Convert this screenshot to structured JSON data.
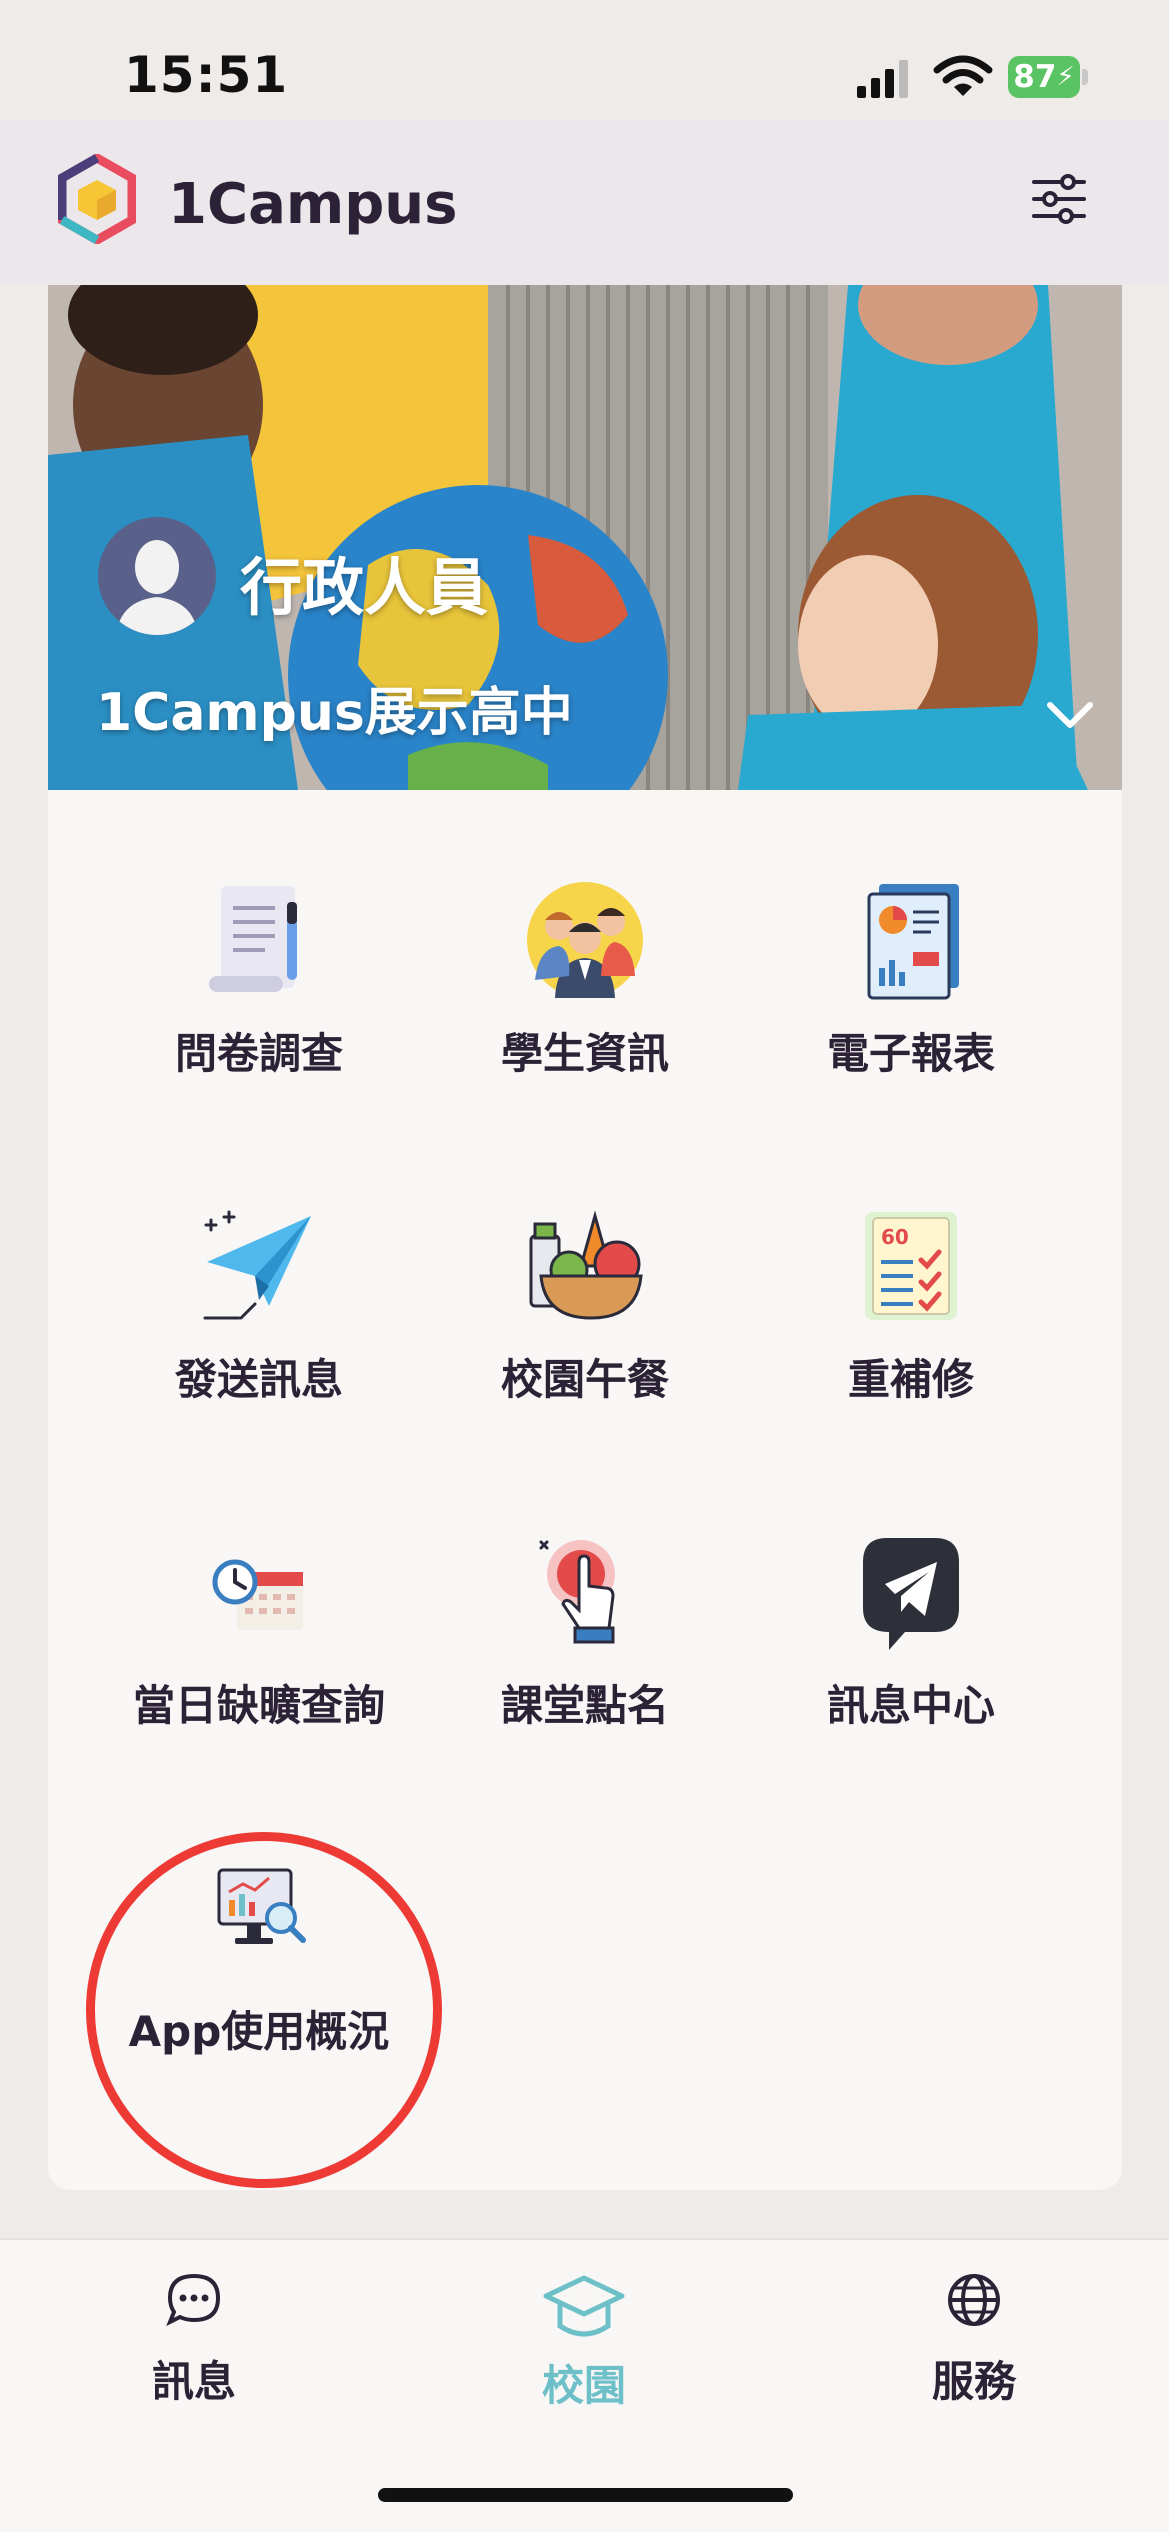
{
  "status_bar": {
    "time": "15:51",
    "battery": "87"
  },
  "header": {
    "app_title": "1Campus"
  },
  "hero": {
    "role": "行政人員",
    "school": "1Campus展示高中"
  },
  "apps": [
    {
      "label": "問卷調查",
      "icon": "survey-scroll-icon"
    },
    {
      "label": "學生資訊",
      "icon": "student-group-icon"
    },
    {
      "label": "電子報表",
      "icon": "report-document-icon"
    },
    {
      "label": "發送訊息",
      "icon": "paper-plane-icon"
    },
    {
      "label": "校園午餐",
      "icon": "lunch-bowl-icon"
    },
    {
      "label": "重補修",
      "icon": "graded-paper-icon"
    },
    {
      "label": "當日缺曠查詢",
      "icon": "clock-calendar-icon"
    },
    {
      "label": "課堂點名",
      "icon": "tap-button-icon"
    },
    {
      "label": "訊息中心",
      "icon": "telegram-icon"
    },
    {
      "label": "App使用概況",
      "icon": "monitor-analytics-icon"
    }
  ],
  "tabs": [
    {
      "label": "訊息",
      "icon": "chat-bubble-icon",
      "active": false
    },
    {
      "label": "校園",
      "icon": "graduation-cap-icon",
      "active": true
    },
    {
      "label": "服務",
      "icon": "globe-icon",
      "active": false
    }
  ],
  "colors": {
    "accent": "#6dc0c8",
    "highlight": "#ee3a35",
    "text": "#2b2236"
  }
}
